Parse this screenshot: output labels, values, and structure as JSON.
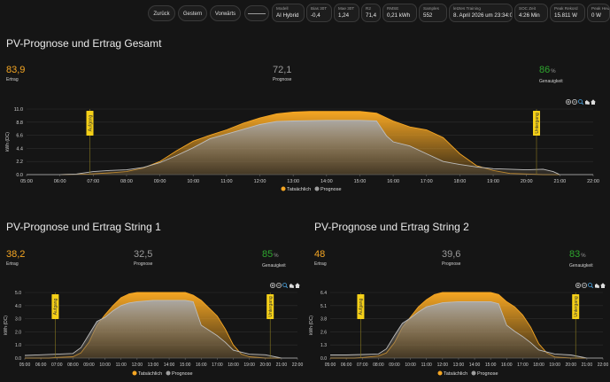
{
  "topbar": {
    "buttons": [
      "Zurück",
      "Gestern",
      "Vorwärts"
    ],
    "stats": [
      {
        "label": "Modell",
        "value": "AI Hybrid"
      },
      {
        "label": "Bias 30T",
        "value": "-0,4"
      },
      {
        "label": "Mae 30T",
        "value": "1,24"
      },
      {
        "label": "R2",
        "value": "71,4"
      },
      {
        "label": "RMSE",
        "value": "0,21 kWh"
      },
      {
        "label": "Samples",
        "value": "552"
      },
      {
        "label": "letztes Training",
        "value": "8. April 2026 um 23:34:09"
      },
      {
        "label": "SOC Zeit",
        "value": "4:26 Min"
      },
      {
        "label": "Peak Rekord",
        "value": "15.811 W"
      },
      {
        "label": "Peak Heute",
        "value": "0 W"
      }
    ]
  },
  "panels": [
    {
      "title": "PV-Prognose und Ertrag Gesamt",
      "ertrag": {
        "value": "83,9",
        "label": "Ertrag"
      },
      "prognose": {
        "value": "72,1",
        "label": "Prognose"
      },
      "genauigkeit": {
        "value": "86",
        "unit": "%",
        "label": "Genauigkeit"
      }
    },
    {
      "title": "PV-Prognose und Ertrag String 1",
      "ertrag": {
        "value": "38,2",
        "label": "Ertrag"
      },
      "prognose": {
        "value": "32,5",
        "label": "Prognose"
      },
      "genauigkeit": {
        "value": "85",
        "unit": "%",
        "label": "Genauigkeit"
      }
    },
    {
      "title": "PV-Prognose und Ertrag String 2",
      "ertrag": {
        "value": "48",
        "label": "Ertrag"
      },
      "prognose": {
        "value": "39,6",
        "label": "Prognose"
      },
      "genauigkeit": {
        "value": "83",
        "unit": "%",
        "label": "Genauigkeit"
      }
    }
  ],
  "colors": {
    "actual": "#f5a623",
    "forecast": "#9e9e9e",
    "marker": "#f5d018"
  },
  "chart_data": [
    {
      "type": "area",
      "ylabel": "kWh (DC)",
      "ylim": [
        0,
        11
      ],
      "yticks": [
        "0.0",
        "2.2",
        "4.4",
        "6.6",
        "8.8",
        "11.0"
      ],
      "x_ticks": [
        "05:00",
        "06:00",
        "07:00",
        "08:00",
        "09:00",
        "10:00",
        "11:00",
        "12:00",
        "13:00",
        "14:00",
        "15:00",
        "16:00",
        "17:00",
        "18:00",
        "19:00",
        "20:00",
        "21:00",
        "22:00"
      ],
      "markers": [
        {
          "label": "Aufgang",
          "time": 6.9
        },
        {
          "label": "Untergang",
          "time": 20.3
        }
      ],
      "series": [
        {
          "name": "Tatsächlich",
          "points": [
            [
              5,
              0
            ],
            [
              6,
              0
            ],
            [
              6.9,
              0.1
            ],
            [
              7.5,
              0.3
            ],
            [
              8,
              0.5
            ],
            [
              8.5,
              1.1
            ],
            [
              9,
              2.2
            ],
            [
              9.5,
              4
            ],
            [
              10,
              5.6
            ],
            [
              10.5,
              6.6
            ],
            [
              11,
              7.5
            ],
            [
              11.5,
              8.6
            ],
            [
              12,
              9.5
            ],
            [
              12.5,
              10.2
            ],
            [
              13,
              10.5
            ],
            [
              13.5,
              10.6
            ],
            [
              14,
              10.6
            ],
            [
              14.5,
              10.6
            ],
            [
              15,
              10.6
            ],
            [
              15.5,
              10.3
            ],
            [
              16,
              9
            ],
            [
              16.5,
              8
            ],
            [
              17,
              7.5
            ],
            [
              17.5,
              6.2
            ],
            [
              18,
              3.5
            ],
            [
              18.5,
              1.5
            ],
            [
              19,
              0.7
            ],
            [
              19.5,
              0.2
            ],
            [
              20,
              0.1
            ],
            [
              20.5,
              0
            ],
            [
              21,
              0
            ],
            [
              22,
              0
            ]
          ]
        },
        {
          "name": "Prognose",
          "points": [
            [
              5,
              0
            ],
            [
              6,
              0
            ],
            [
              6.5,
              0.1
            ],
            [
              7,
              0.5
            ],
            [
              7.5,
              0.7
            ],
            [
              8,
              0.8
            ],
            [
              8.5,
              1.2
            ],
            [
              9,
              2
            ],
            [
              9.5,
              3.2
            ],
            [
              10,
              4.5
            ],
            [
              10.5,
              6
            ],
            [
              11,
              6.8
            ],
            [
              11.5,
              7.6
            ],
            [
              12,
              8.4
            ],
            [
              12.5,
              8.9
            ],
            [
              13,
              9
            ],
            [
              14,
              9.1
            ],
            [
              15,
              9.1
            ],
            [
              15.5,
              9
            ],
            [
              15.8,
              6.5
            ],
            [
              16,
              5.5
            ],
            [
              16.5,
              4.8
            ],
            [
              17,
              3.5
            ],
            [
              17.5,
              2.2
            ],
            [
              18,
              1.7
            ],
            [
              18.5,
              1.3
            ],
            [
              19,
              1
            ],
            [
              19.5,
              0.9
            ],
            [
              20,
              0.8
            ],
            [
              20.5,
              0.9
            ],
            [
              20.8,
              0.5
            ],
            [
              21,
              0
            ],
            [
              22,
              0
            ]
          ]
        }
      ]
    },
    {
      "type": "area",
      "ylabel": "kWh (DC)",
      "ylim": [
        0,
        5
      ],
      "yticks": [
        "0.0",
        "1.0",
        "2.0",
        "3.0",
        "4.0",
        "5.0"
      ],
      "x_ticks": [
        "05:00",
        "06:00",
        "07:00",
        "08:00",
        "09:00",
        "10:00",
        "11:00",
        "12:00",
        "13:00",
        "14:00",
        "15:00",
        "16:00",
        "17:00",
        "18:00",
        "19:00",
        "20:00",
        "21:00",
        "22:00"
      ],
      "markers": [
        {
          "label": "Aufgang",
          "time": 6.9
        },
        {
          "label": "Untergang",
          "time": 20.3
        }
      ],
      "series": [
        {
          "name": "Tatsächlich",
          "points": [
            [
              5,
              0
            ],
            [
              6.5,
              0
            ],
            [
              7,
              0.05
            ],
            [
              8,
              0.1
            ],
            [
              8.5,
              0.4
            ],
            [
              9,
              1.2
            ],
            [
              9.5,
              2.5
            ],
            [
              10,
              3.3
            ],
            [
              10.5,
              4
            ],
            [
              11,
              4.6
            ],
            [
              11.5,
              4.9
            ],
            [
              12,
              5
            ],
            [
              13,
              5
            ],
            [
              14,
              5
            ],
            [
              15,
              5
            ],
            [
              15.5,
              4.8
            ],
            [
              16,
              4.4
            ],
            [
              16.5,
              3.8
            ],
            [
              17,
              3.2
            ],
            [
              17.5,
              2.2
            ],
            [
              18,
              1
            ],
            [
              18.5,
              0.3
            ],
            [
              19,
              0.1
            ],
            [
              20,
              0
            ],
            [
              22,
              0
            ]
          ]
        },
        {
          "name": "Prognose",
          "points": [
            [
              5,
              0.2
            ],
            [
              6,
              0.25
            ],
            [
              7,
              0.3
            ],
            [
              8,
              0.35
            ],
            [
              8.5,
              0.8
            ],
            [
              9,
              1.8
            ],
            [
              9.5,
              2.8
            ],
            [
              10,
              3.1
            ],
            [
              10.5,
              3.6
            ],
            [
              11,
              4
            ],
            [
              11.5,
              4.2
            ],
            [
              12,
              4.3
            ],
            [
              13,
              4.4
            ],
            [
              14,
              4.4
            ],
            [
              15,
              4.4
            ],
            [
              15.5,
              4.3
            ],
            [
              16,
              2.5
            ],
            [
              16.5,
              2.1
            ],
            [
              17,
              1.7
            ],
            [
              17.5,
              1.2
            ],
            [
              18,
              0.6
            ],
            [
              19,
              0.3
            ],
            [
              20,
              0.25
            ],
            [
              21,
              0
            ],
            [
              22,
              0
            ]
          ]
        }
      ]
    },
    {
      "type": "area",
      "ylabel": "kWh (DC)",
      "ylim": [
        0,
        6.4
      ],
      "yticks": [
        "0.0",
        "1.3",
        "2.6",
        "3.8",
        "5.1",
        "6.4"
      ],
      "x_ticks": [
        "05:00",
        "06:00",
        "07:00",
        "08:00",
        "09:00",
        "10:00",
        "11:00",
        "12:00",
        "13:00",
        "14:00",
        "15:00",
        "16:00",
        "17:00",
        "18:00",
        "19:00",
        "20:00",
        "21:00",
        "22:00"
      ],
      "markers": [
        {
          "label": "Aufgang",
          "time": 6.9
        },
        {
          "label": "Untergang",
          "time": 20.3
        }
      ],
      "series": [
        {
          "name": "Tatsächlich",
          "points": [
            [
              5,
              0
            ],
            [
              6.5,
              0
            ],
            [
              7,
              0.05
            ],
            [
              8,
              0.2
            ],
            [
              8.5,
              0.5
            ],
            [
              9,
              1.5
            ],
            [
              9.5,
              3
            ],
            [
              10,
              4
            ],
            [
              10.5,
              5
            ],
            [
              11,
              5.7
            ],
            [
              11.5,
              6.2
            ],
            [
              12,
              6.4
            ],
            [
              13,
              6.4
            ],
            [
              14,
              6.4
            ],
            [
              15,
              6.4
            ],
            [
              15.5,
              6.2
            ],
            [
              16,
              5.5
            ],
            [
              16.5,
              5
            ],
            [
              17,
              4.2
            ],
            [
              17.5,
              3
            ],
            [
              18,
              1.4
            ],
            [
              18.5,
              0.5
            ],
            [
              19,
              0.1
            ],
            [
              20,
              0
            ],
            [
              22,
              0
            ]
          ]
        },
        {
          "name": "Prognose",
          "points": [
            [
              5,
              0.3
            ],
            [
              6,
              0.3
            ],
            [
              7,
              0.35
            ],
            [
              8,
              0.4
            ],
            [
              8.5,
              0.9
            ],
            [
              9,
              2.2
            ],
            [
              9.5,
              3.4
            ],
            [
              10,
              3.9
            ],
            [
              10.5,
              4.5
            ],
            [
              11,
              5
            ],
            [
              11.5,
              5.2
            ],
            [
              12,
              5.4
            ],
            [
              13,
              5.5
            ],
            [
              14,
              5.5
            ],
            [
              15,
              5.5
            ],
            [
              15.5,
              5.3
            ],
            [
              16,
              3.2
            ],
            [
              16.5,
              2.6
            ],
            [
              17,
              2.1
            ],
            [
              17.5,
              1.5
            ],
            [
              18,
              0.8
            ],
            [
              19,
              0.4
            ],
            [
              20,
              0.3
            ],
            [
              21,
              0
            ],
            [
              22,
              0
            ]
          ]
        }
      ]
    }
  ]
}
